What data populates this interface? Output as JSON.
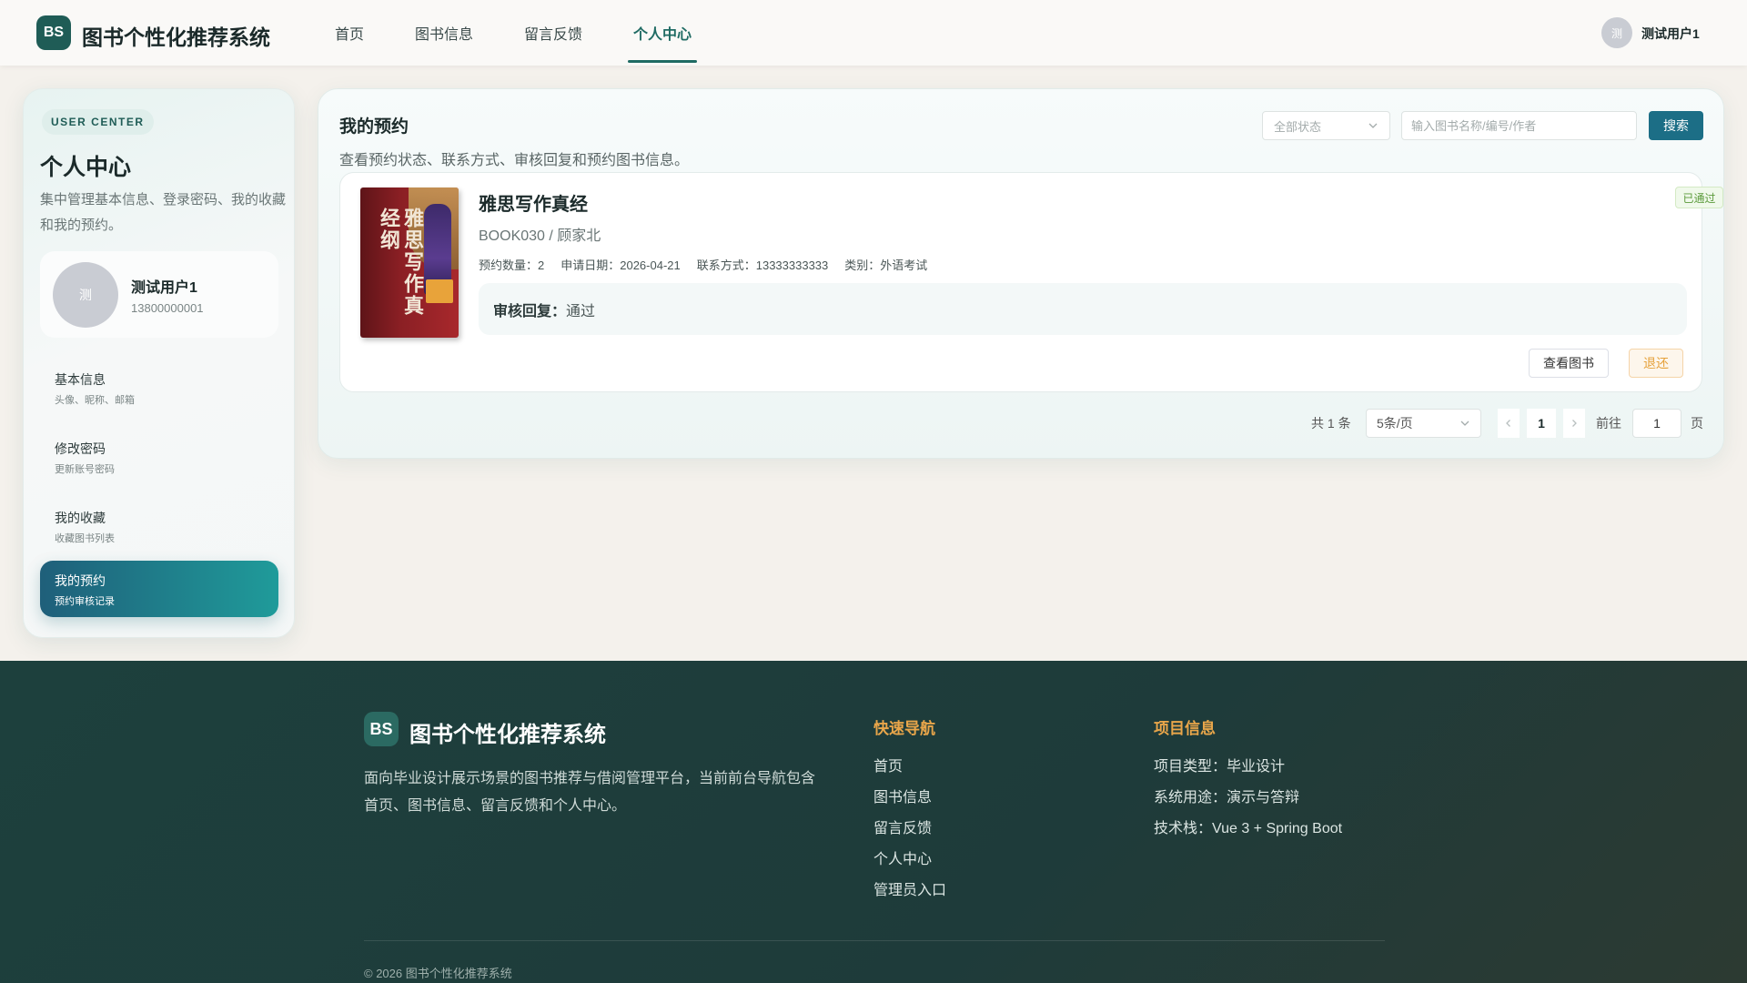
{
  "header": {
    "logo_badge": "BS",
    "app_title": "图书个性化推荐系统",
    "nav": [
      "首页",
      "图书信息",
      "留言反馈",
      "个人中心"
    ],
    "active_nav": "个人中心",
    "user_avatar_text": "测",
    "user_name": "测试用户1"
  },
  "sidebar": {
    "tag": "USER CENTER",
    "title": "个人中心",
    "description": "集中管理基本信息、登录密码、我的收藏和我的预约。",
    "profile": {
      "avatar_text": "测",
      "name": "测试用户1",
      "phone": "13800000001"
    },
    "menu": [
      {
        "title": "基本信息",
        "sub": "头像、昵称、邮箱"
      },
      {
        "title": "修改密码",
        "sub": "更新账号密码"
      },
      {
        "title": "我的收藏",
        "sub": "收藏图书列表"
      },
      {
        "title": "我的预约",
        "sub": "预约审核记录"
      }
    ],
    "active_menu": "我的预约"
  },
  "main": {
    "title": "我的预约",
    "description": "查看预约状态、联系方式、审核回复和预约图书信息。",
    "status_filter": "全部状态",
    "search_placeholder": "输入图书名称/编号/作者",
    "search_button": "搜索",
    "reservations": [
      {
        "cover_text": "雅思写作真经纲",
        "title": "雅思写作真经",
        "meta": "BOOK030 / 顾家北",
        "quantity": "预约数量：2",
        "apply_date": "申请日期：2026-04-21",
        "contact": "联系方式：13333333333",
        "category": "类别：外语考试",
        "reply_label": "审核回复：",
        "reply_value": "通过",
        "status": "已通过",
        "view_button": "查看图书",
        "return_button": "退还"
      }
    ],
    "pagination": {
      "total": "共 1 条",
      "page_size": "5条/页",
      "current_page": "1",
      "goto_label": "前往",
      "goto_value": "1",
      "page_suffix": "页"
    }
  },
  "footer": {
    "logo_badge": "BS",
    "title": "图书个性化推荐系统",
    "description": "面向毕业设计展示场景的图书推荐与借阅管理平台，当前前台导航包含首页、图书信息、留言反馈和个人中心。",
    "quick_nav_title": "快速导航",
    "quick_nav": [
      "首页",
      "图书信息",
      "留言反馈",
      "个人中心",
      "管理员入口"
    ],
    "project_title": "项目信息",
    "project_info": [
      "项目类型：毕业设计",
      "系统用途：演示与答辩",
      "技术栈：Vue 3 + Spring Boot"
    ],
    "copyright": "© 2026 图书个性化推荐系统"
  },
  "colors": {
    "brand": "#1f5c56",
    "accent_button": "#1c6e86",
    "status_approved": "#5a9a3a",
    "return_warning": "#e6a23c",
    "footer_heading": "#e9a64a"
  }
}
